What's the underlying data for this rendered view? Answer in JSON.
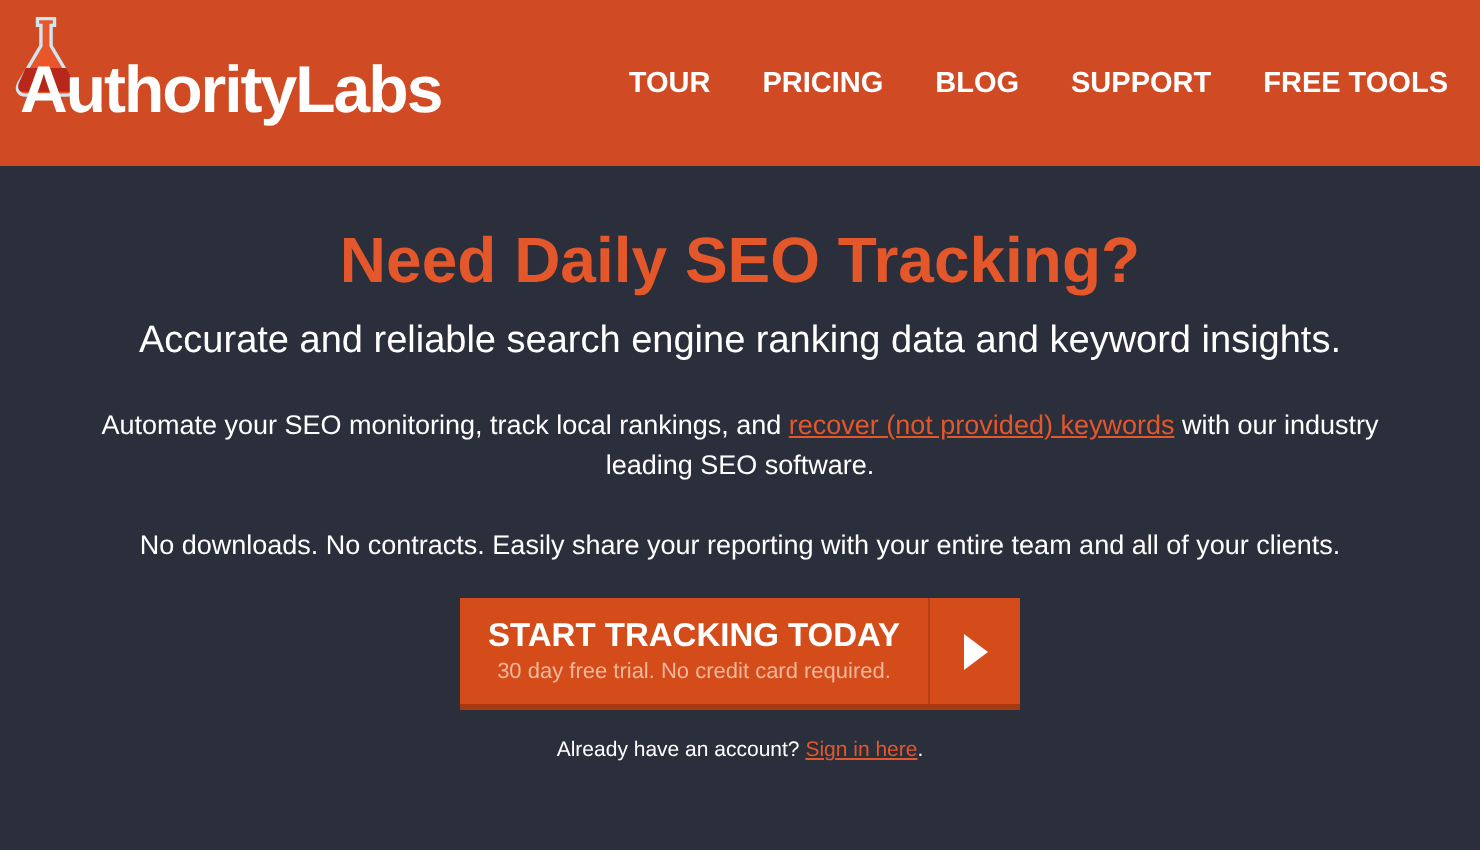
{
  "header": {
    "logo": "AuthorityLabs",
    "nav": [
      {
        "label": "TOUR"
      },
      {
        "label": "PRICING"
      },
      {
        "label": "BLOG"
      },
      {
        "label": "SUPPORT"
      },
      {
        "label": "FREE TOOLS"
      }
    ]
  },
  "hero": {
    "headline": "Need Daily SEO Tracking?",
    "subtitle": "Accurate and reliable search engine ranking data and keyword insights.",
    "intro": {
      "before": "Automate your SEO monitoring, track local rankings, and ",
      "link": "recover (not provided) keywords",
      "after": " with our industry leading SEO software."
    },
    "note": "No downloads. No contracts. Easily share your reporting with your entire team and all of your clients.",
    "cta": {
      "title": "START TRACKING TODAY",
      "subtitle": "30 day free trial. No credit card required."
    },
    "signin": {
      "before": "Already have an account? ",
      "link": "Sign in here",
      "after": "."
    }
  }
}
